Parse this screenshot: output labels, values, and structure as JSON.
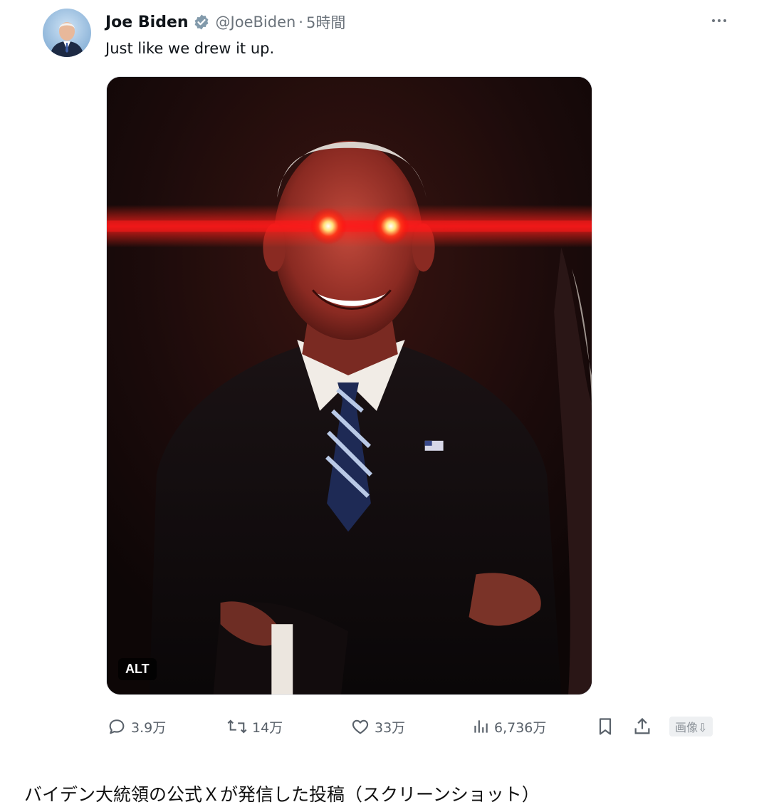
{
  "tweet": {
    "display_name": "Joe Biden",
    "handle": "@JoeBiden",
    "separator": "·",
    "time": "5時間",
    "text": "Just like we drew it up.",
    "media_alt_badge": "ALT"
  },
  "actions": {
    "replies": "3.9万",
    "reposts": "14万",
    "likes": "33万",
    "views": "6,736万",
    "image_label": "画像⇩"
  },
  "icons": {
    "verified": "verified-badge-icon",
    "more": "more-options-icon",
    "reply": "reply-icon",
    "repost": "repost-icon",
    "like": "heart-icon",
    "views": "views-icon",
    "bookmark": "bookmark-icon",
    "share": "share-icon"
  },
  "colors": {
    "verified_badge": "#829aab",
    "secondary_text": "#6b737b",
    "laser": "#ff1a1a"
  },
  "caption": "バイデン大統領の公式Ｘが発信した投稿（スクリーンショット）"
}
